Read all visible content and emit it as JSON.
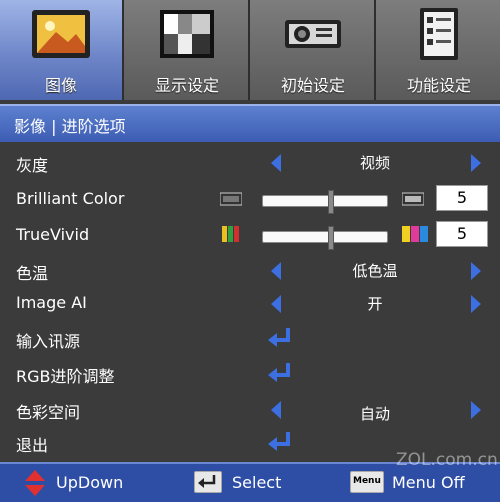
{
  "tabs": [
    {
      "label": "图像",
      "icon": "picture-icon"
    },
    {
      "label": "显示设定",
      "icon": "display-icon"
    },
    {
      "label": "初始设定",
      "icon": "projector-icon"
    },
    {
      "label": "功能设定",
      "icon": "checklist-icon"
    }
  ],
  "breadcrumb": "影像 | 进阶选项",
  "rows": {
    "gamma": {
      "label": "灰度",
      "value": "视频"
    },
    "brilliant": {
      "label": "Brilliant Color",
      "value": "5",
      "level_fraction": 0.55
    },
    "truevivid": {
      "label": "TrueVivid",
      "value": "5",
      "level_fraction": 0.55
    },
    "colortemp": {
      "label": "色温",
      "value": "低色温"
    },
    "imageai": {
      "label": "Image AI",
      "value": "开"
    },
    "source": {
      "label": "输入讯源"
    },
    "rgb": {
      "label": "RGB进阶调整"
    },
    "colorspace": {
      "label": "色彩空间",
      "value": "自动"
    },
    "exit": {
      "label": "退出"
    }
  },
  "footer": {
    "updown": "UpDown",
    "select": "Select",
    "menuoff": "Menu Off",
    "menu_key": "Menu"
  },
  "watermark": "ZOL.com.cn",
  "colors": {
    "accent": "#3b6fe2",
    "tab_active": "#6f87c9",
    "footer": "#2e4ea6"
  }
}
